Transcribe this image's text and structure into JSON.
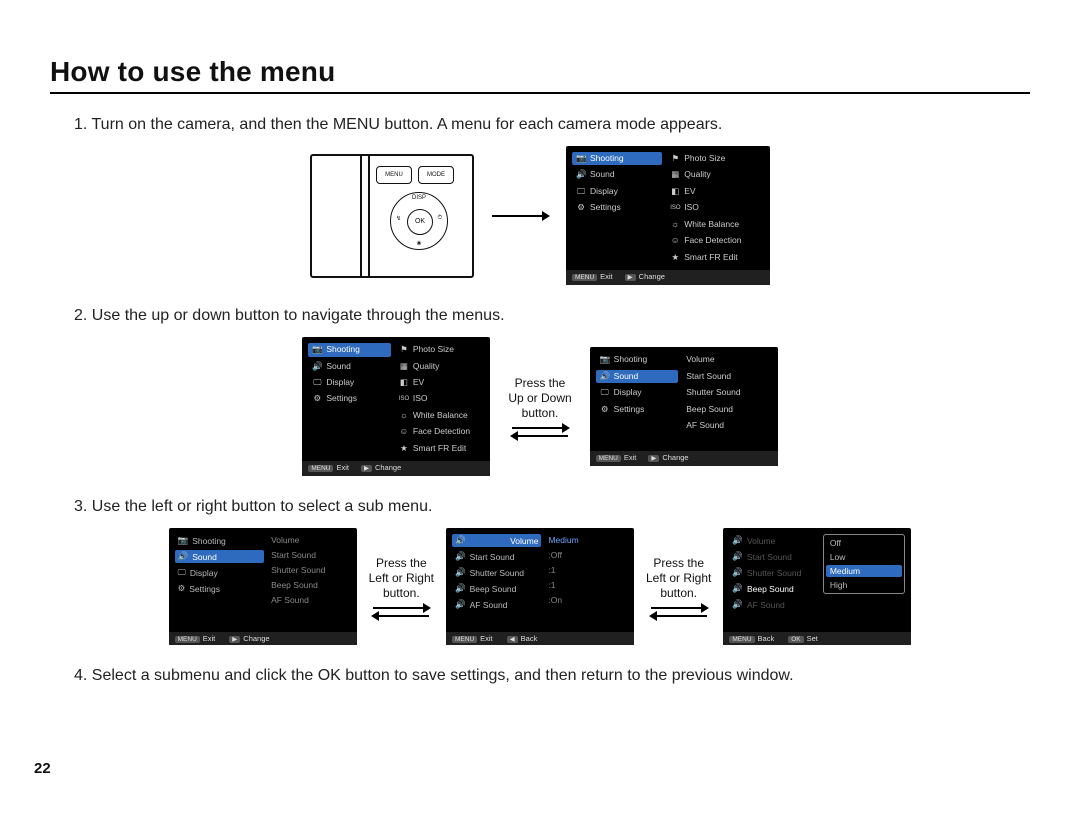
{
  "title": "How to use the menu",
  "page_number": "22",
  "steps": {
    "s1": "1. Turn on the camera, and then the MENU button. A menu for each camera mode appears.",
    "s2": "2. Use the up or down button to navigate through the menus.",
    "s3": "3. Use the left or right button to select a sub menu.",
    "s4": "4. Select a submenu and click the OK button to save settings, and then return to the previous window."
  },
  "labels": {
    "up_down": "Press the\nUp or Down\nbutton.",
    "left_right": "Press the\nLeft or Right\nbutton."
  },
  "camera": {
    "menu": "MENU",
    "mode": "MODE",
    "ok": "OK",
    "disp": "DISP"
  },
  "main_menu": {
    "tabs": {
      "shooting": "Shooting",
      "sound": "Sound",
      "display": "Display",
      "settings": "Settings"
    },
    "shooting_items": {
      "photo_size": "Photo Size",
      "quality": "Quality",
      "ev": "EV",
      "iso": "ISO",
      "white_balance": "White Balance",
      "face_detection": "Face Detection",
      "smart_fr": "Smart FR Edit"
    },
    "sound_items": {
      "volume": "Volume",
      "start_sound": "Start Sound",
      "shutter_sound": "Shutter Sound",
      "beep_sound": "Beep Sound",
      "af_sound": "AF Sound"
    }
  },
  "footers": {
    "menu": "MENU",
    "exit": "Exit",
    "change": "Change",
    "back": "Back",
    "ok": "OK",
    "set": "Set"
  },
  "submenu_values": {
    "volume_val": "Medium",
    "start_sound_val": ":Off",
    "shutter_sound_val": ":1",
    "beep_sound_val": ":1",
    "af_sound_val": ":On"
  },
  "volume_options": {
    "off": "Off",
    "low": "Low",
    "medium": "Medium",
    "high": "High"
  },
  "icons": {
    "camera": "📷",
    "speaker": "🔊",
    "display": "🖵",
    "gear": "⚙",
    "flag": "⚑",
    "quality": "▦",
    "ev": "◧",
    "iso": "ISO",
    "wb": "☼",
    "face": "☺",
    "star": "★",
    "left": "◀",
    "right": "▶"
  }
}
